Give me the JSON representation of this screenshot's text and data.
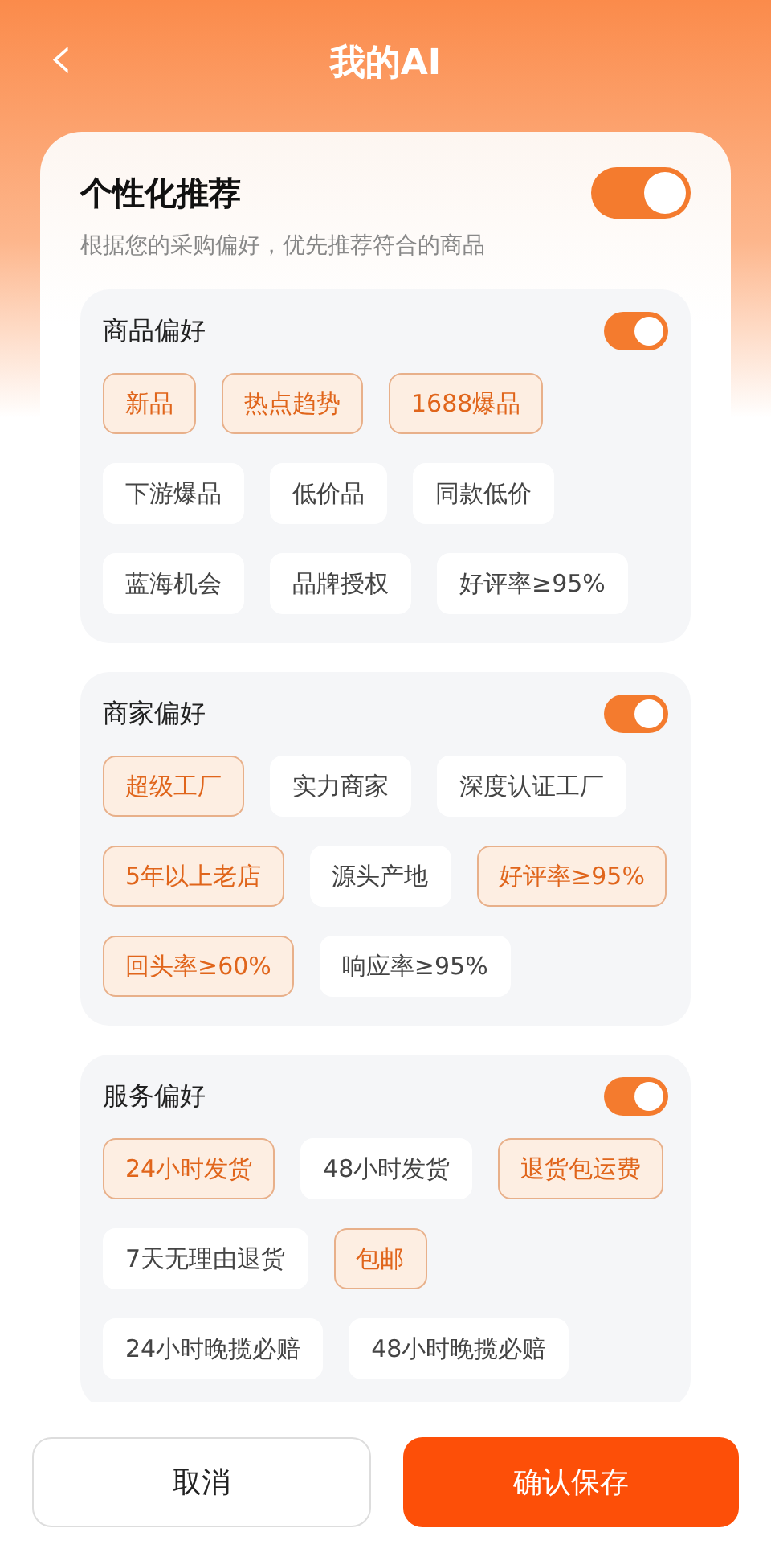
{
  "header": {
    "back_icon": "‹",
    "title": "我的AI"
  },
  "main": {
    "title": "个性化推荐",
    "on": true,
    "description": "根据您的采购偏好，优先推荐符合的商品"
  },
  "sections": [
    {
      "title": "商品偏好",
      "on": true,
      "tags": [
        {
          "label": "新品",
          "selected": true
        },
        {
          "label": "热点趋势",
          "selected": true
        },
        {
          "label": "1688爆品",
          "selected": true
        },
        {
          "label": "下游爆品",
          "selected": false
        },
        {
          "label": "低价品",
          "selected": false
        },
        {
          "label": "同款低价",
          "selected": false
        },
        {
          "label": "蓝海机会",
          "selected": false
        },
        {
          "label": "品牌授权",
          "selected": false
        },
        {
          "label": "好评率≥95%",
          "selected": false
        }
      ]
    },
    {
      "title": "商家偏好",
      "on": true,
      "tags": [
        {
          "label": "超级工厂",
          "selected": true
        },
        {
          "label": "实力商家",
          "selected": false
        },
        {
          "label": "深度认证工厂",
          "selected": false
        },
        {
          "label": "5年以上老店",
          "selected": true
        },
        {
          "label": "源头产地",
          "selected": false
        },
        {
          "label": "好评率≥95%",
          "selected": true
        },
        {
          "label": "回头率≥60%",
          "selected": true
        },
        {
          "label": "响应率≥95%",
          "selected": false
        }
      ]
    },
    {
      "title": "服务偏好",
      "on": true,
      "tags": [
        {
          "label": "24小时发货",
          "selected": true
        },
        {
          "label": "48小时发货",
          "selected": false
        },
        {
          "label": "退货包运费",
          "selected": true
        },
        {
          "label": "7天无理由退货",
          "selected": false
        },
        {
          "label": "包邮",
          "selected": true
        },
        {
          "label": "24小时晚揽必赔",
          "selected": false
        },
        {
          "label": "48小时晚揽必赔",
          "selected": false
        }
      ]
    }
  ],
  "buttons": {
    "cancel": "取消",
    "confirm": "确认保存"
  }
}
